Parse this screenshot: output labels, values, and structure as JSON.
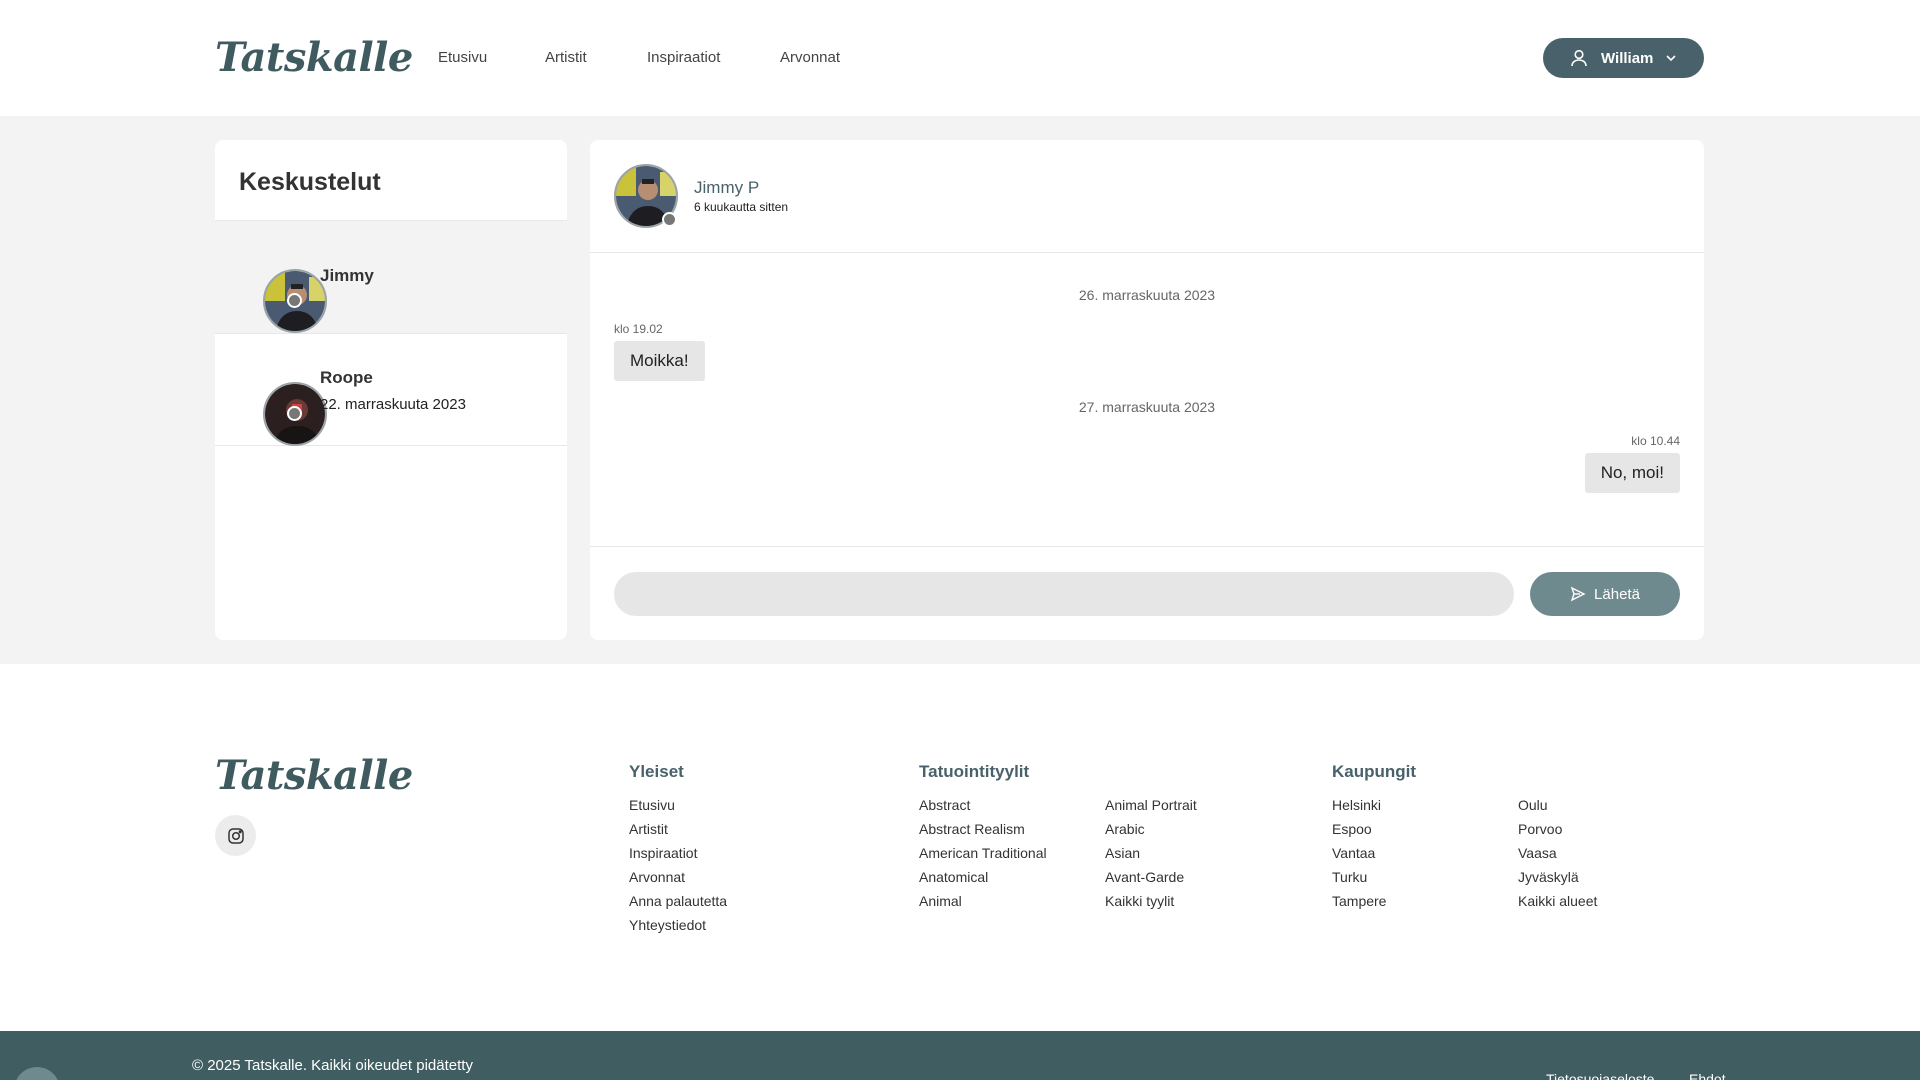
{
  "header": {
    "logo": "Tatskalle",
    "nav": [
      "Etusivu",
      "Artistit",
      "Inspiraatiot",
      "Arvonnat"
    ],
    "user": "William"
  },
  "conversations": {
    "title": "Keskustelut",
    "items": [
      {
        "name": "Jimmy",
        "date": ""
      },
      {
        "name": "Roope",
        "date": "22. marraskuuta 2023"
      }
    ]
  },
  "chat": {
    "name": "Jimmy P",
    "last_seen": "6 kuukautta sitten",
    "messages": [
      {
        "date": "26. marraskuuta 2023",
        "time": "klo 19.02",
        "text": "Moikka!",
        "side": "left"
      },
      {
        "date": "27. marraskuuta 2023",
        "time": "klo 10.44",
        "text": "No, moi!",
        "side": "right"
      }
    ],
    "input_placeholder": "",
    "send_label": "Lähetä"
  },
  "footer": {
    "logo": "Tatskalle",
    "instagram_icon": "instagram-icon",
    "general": {
      "title": "Yleiset",
      "links": [
        "Etusivu",
        "Artistit",
        "Inspiraatiot",
        "Arvonnat",
        "Anna palautetta",
        "Yhteystiedot"
      ]
    },
    "styles": {
      "title": "Tatuointityylit",
      "col1": [
        "Abstract",
        "Abstract Realism",
        "American Traditional",
        "Anatomical",
        "Animal"
      ],
      "col2": [
        "Animal Portrait",
        "Arabic",
        "Asian",
        "Avant-Garde",
        "Kaikki tyylit"
      ]
    },
    "cities": {
      "title": "Kaupungit",
      "col1": [
        "Helsinki",
        "Espoo",
        "Vantaa",
        "Turku",
        "Tampere"
      ],
      "col2": [
        "Oulu",
        "Porvoo",
        "Vaasa",
        "Jyväskylä",
        "Kaikki alueet"
      ]
    },
    "copyright": "© 2025 Tatskalle. Kaikki oikeudet pidätetty",
    "bottom_links": [
      "Tietosuojaseloste",
      "Ehdot"
    ]
  },
  "colors": {
    "brand": "#48616a",
    "send_button": "#6f8a8f",
    "bottom_bar": "#405d62"
  }
}
